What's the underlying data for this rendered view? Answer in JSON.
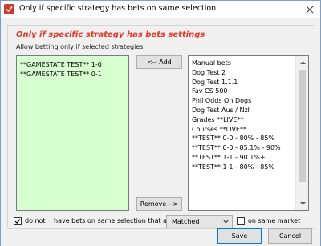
{
  "window": {
    "title": "Only if specific strategy has bets on same selection",
    "close_glyph": "✕"
  },
  "settings": {
    "header": "Only if specific strategy has bets settings",
    "subtext": "Allow betting only if selected strategies"
  },
  "selected_list": {
    "items": [
      "**GAMESTATE TEST**   1-0",
      "**GAMESTATE TEST**   0-1"
    ]
  },
  "available_list": {
    "items": [
      "Manual bets",
      "Dog Test 2",
      "Dog Test 1.1.1",
      "Fav CS 500",
      "Phil Odds On Dogs",
      "Dog Test Aus / Nzl",
      "Grades **LIVE**",
      "Courses **LIVE**",
      "**TEST**  0-0 -  80% - 85%",
      "**TEST**  0-0 -  85.1% - 90%",
      "**TEST**  1-1 - 90.1%+",
      "**TEST**  1-1 -  80% - 85%"
    ]
  },
  "buttons": {
    "add": "<-- Add",
    "remove": "Remove -->",
    "save": "Save",
    "cancel": "Cancel"
  },
  "condition": {
    "do_not_label": "do not",
    "do_not_checked": true,
    "phrase": "have bets on same selection that are",
    "status_value": "Matched",
    "same_market_label": "on same market",
    "same_market_checked": false
  },
  "icons": {
    "app": "app-icon",
    "close": "close-icon",
    "scroll_up": "chevron-up-icon",
    "scroll_down": "chevron-down-icon",
    "dropdown": "chevron-down-icon",
    "check": "checkmark-icon"
  },
  "colors": {
    "header": "#e03a2a",
    "selected_list_bg": "#d8ffd0",
    "app_icon": "#d23a2a"
  }
}
